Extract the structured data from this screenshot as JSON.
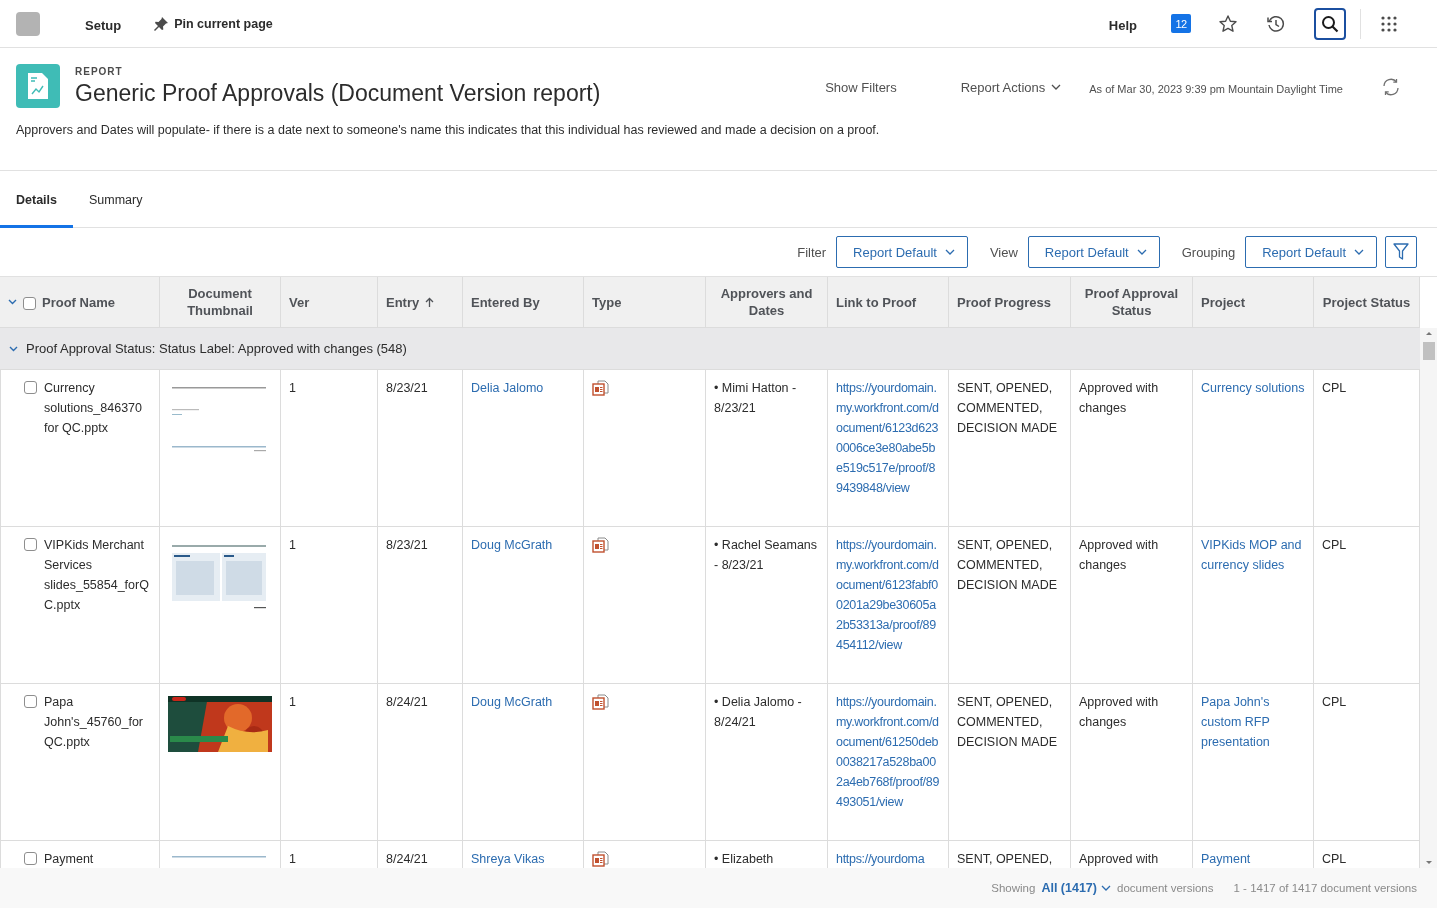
{
  "topbar": {
    "setup": "Setup",
    "pin": "Pin current page",
    "help": "Help",
    "badge": "12"
  },
  "header": {
    "eyebrow": "REPORT",
    "title": "Generic Proof Approvals (Document Version report)",
    "show_filters": "Show Filters",
    "report_actions": "Report Actions",
    "as_of": "As of Mar 30, 2023 9:39 pm Mountain Daylight Time",
    "description": "Approvers and Dates will populate- if there is a date next to someone's name this indicates that this individual has reviewed and made a decision on a proof."
  },
  "tabs": [
    {
      "label": "Details",
      "selected": true
    },
    {
      "label": "Summary",
      "selected": false
    }
  ],
  "toolbar": [
    {
      "label": "Filter",
      "value": "Report Default"
    },
    {
      "label": "View",
      "value": "Report Default"
    },
    {
      "label": "Grouping",
      "value": "Report Default"
    }
  ],
  "table": {
    "all_checked": false,
    "columns": [
      {
        "label": "Proof Name",
        "sorted": false
      },
      {
        "label": "Document Thumbnail",
        "sorted": false
      },
      {
        "label": "Ver",
        "sorted": false
      },
      {
        "label": "Entry",
        "sorted": true
      },
      {
        "label": "Entered By",
        "sorted": false
      },
      {
        "label": "Type",
        "sorted": false
      },
      {
        "label": "Approvers and Dates",
        "sorted": false
      },
      {
        "label": "Link to Proof",
        "sorted": false
      },
      {
        "label": "Proof Progress",
        "sorted": false
      },
      {
        "label": "Proof Approval Status",
        "sorted": false
      },
      {
        "label": "Project",
        "sorted": false
      },
      {
        "label": "Project Status",
        "sorted": false
      }
    ],
    "group": {
      "label": "Proof Approval Status: Status Label: Approved with changes (548)",
      "expanded": true
    },
    "rows": [
      {
        "checked": false,
        "name": "Currency solutions_846370 for QC.pptx",
        "ver": "1",
        "entry": "8/23/21",
        "entered_by": "Delia Jalomo",
        "approvers": "• Mimi Hatton - 8/23/21",
        "link": "https://yourdomain.my.workfront.com/document/6123d6230006ce3e80abe5be519c517e/proof/89439848/view",
        "progress": "SENT, OPENED, COMMENTED, DECISION MADE",
        "status": "Approved with changes",
        "project": "Currency solutions",
        "project_status": "CPL"
      },
      {
        "checked": false,
        "name": "VIPKids Merchant Services slides_55854_forQC.pptx",
        "ver": "1",
        "entry": "8/23/21",
        "entered_by": "Doug McGrath",
        "approvers": "• Rachel Seamans - 8/23/21",
        "link": "https://yourdomain.my.workfront.com/document/6123fabf00201a29be30605a2b53313a/proof/89454112/view",
        "progress": "SENT, OPENED, COMMENTED, DECISION MADE",
        "status": "Approved with changes",
        "project": "VIPKids MOP and currency slides",
        "project_status": "CPL"
      },
      {
        "checked": false,
        "name": "Papa John's_45760_forQC.pptx",
        "ver": "1",
        "entry": "8/24/21",
        "entered_by": "Doug McGrath",
        "approvers": "• Delia Jalomo - 8/24/21",
        "link": "https://yourdomain.my.workfront.com/document/61250deb0038217a528ba002a4eb768f/proof/89493051/view",
        "progress": "SENT, OPENED, COMMENTED, DECISION MADE",
        "status": "Approved with changes",
        "project": "Papa John's custom RFP presentation",
        "project_status": "CPL"
      },
      {
        "checked": false,
        "name": "Payment",
        "ver": "1",
        "entry": "8/24/21",
        "entered_by": "Shreya Vikas",
        "approvers": "• Elizabeth",
        "link": "https://yourdoma",
        "progress": "SENT, OPENED,",
        "status": "Approved with",
        "project": "Payment",
        "project_status": "CPL"
      }
    ]
  },
  "footer": {
    "showing": "Showing",
    "count": "All (1417)",
    "suffix": "document versions",
    "range": "1 - 1417 of 1417 document versions"
  }
}
